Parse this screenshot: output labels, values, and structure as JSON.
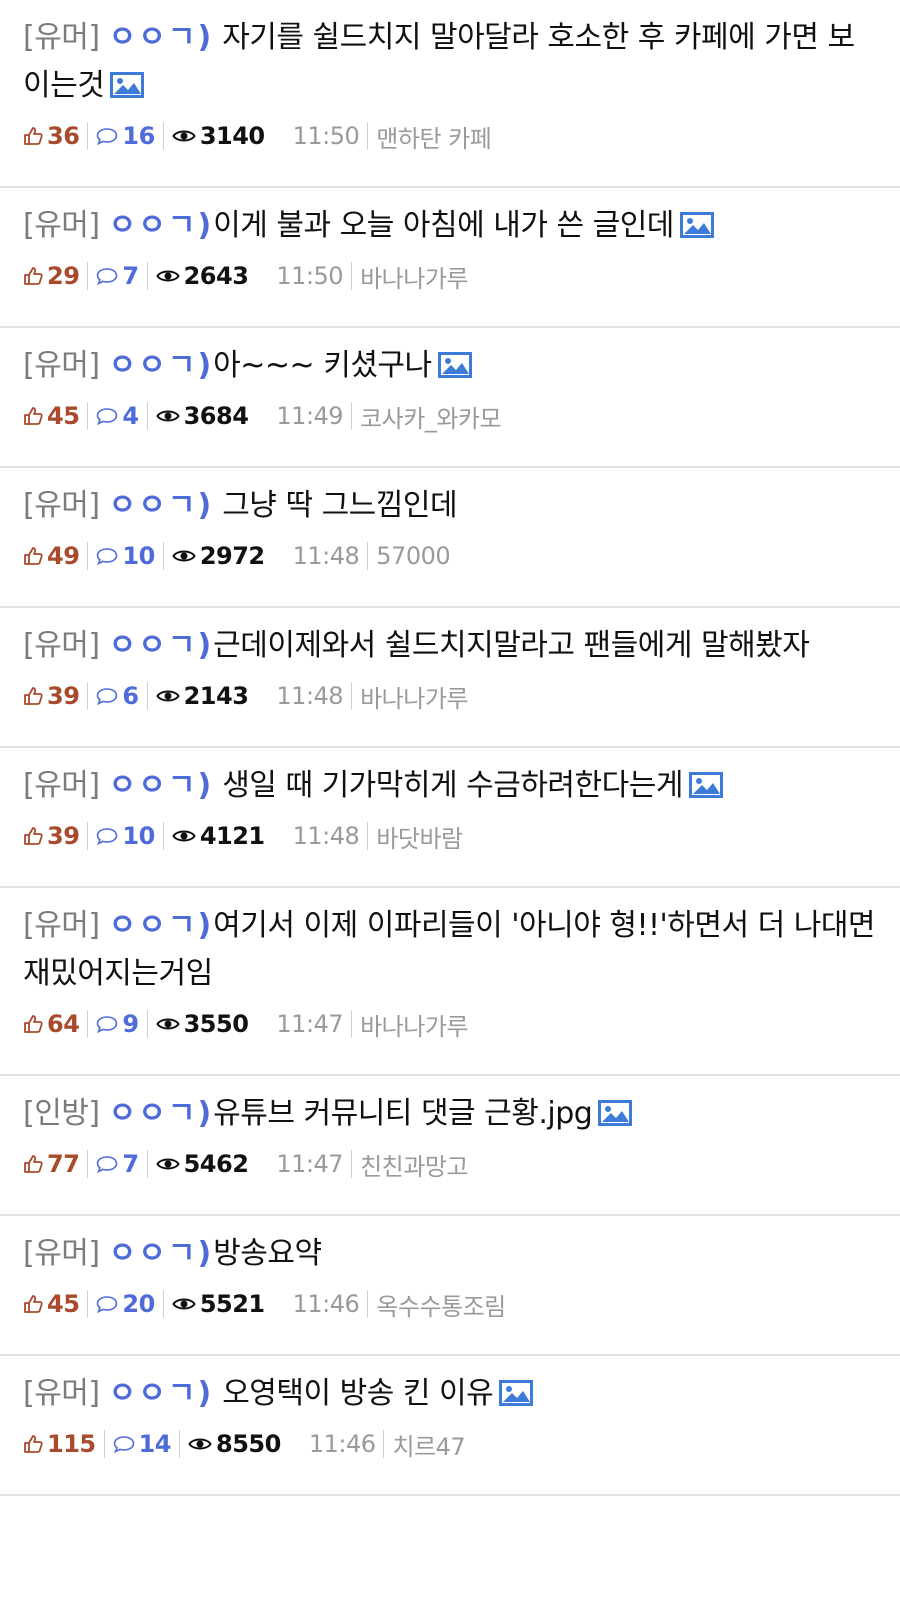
{
  "posts": [
    {
      "category": "[유머]",
      "gosu": "ㅇㅇㄱ)",
      "title": " 자기를 쉴드치지 말아달라 호소한 후 카페에 가면 보이는것",
      "has_image": true,
      "likes": "36",
      "comments": "16",
      "views": "3140",
      "time": "11:50",
      "author": "맨하탄 카페"
    },
    {
      "category": "[유머]",
      "gosu": "ㅇㅇㄱ)",
      "title": "이게 불과 오늘 아침에 내가 쓴 글인데",
      "has_image": true,
      "likes": "29",
      "comments": "7",
      "views": "2643",
      "time": "11:50",
      "author": "바나나가루"
    },
    {
      "category": "[유머]",
      "gosu": "ㅇㅇㄱ)",
      "title": "아~~~ 키셨구나",
      "has_image": true,
      "likes": "45",
      "comments": "4",
      "views": "3684",
      "time": "11:49",
      "author": "코사카_와카모"
    },
    {
      "category": "[유머]",
      "gosu": "ㅇㅇㄱ)",
      "title": " 그냥 딱 그느낌인데",
      "has_image": false,
      "likes": "49",
      "comments": "10",
      "views": "2972",
      "time": "11:48",
      "author": "57000"
    },
    {
      "category": "[유머]",
      "gosu": "ㅇㅇㄱ)",
      "title": "근데이제와서 쉴드치지말라고 팬들에게 말해봤자",
      "has_image": false,
      "likes": "39",
      "comments": "6",
      "views": "2143",
      "time": "11:48",
      "author": "바나나가루"
    },
    {
      "category": "[유머]",
      "gosu": "ㅇㅇㄱ)",
      "title": " 생일 때 기가막히게 수금하려한다는게",
      "has_image": true,
      "likes": "39",
      "comments": "10",
      "views": "4121",
      "time": "11:48",
      "author": "바닷바람"
    },
    {
      "category": "[유머]",
      "gosu": "ㅇㅇㄱ)",
      "title": "여기서 이제 이파리들이 '아니야 형!!'하면서 더 나대면 재밌어지는거임",
      "has_image": false,
      "likes": "64",
      "comments": "9",
      "views": "3550",
      "time": "11:47",
      "author": "바나나가루"
    },
    {
      "category": "[인방]",
      "gosu": "ㅇㅇㄱ)",
      "title": "유튜브 커뮤니티 댓글 근황.jpg",
      "has_image": true,
      "likes": "77",
      "comments": "7",
      "views": "5462",
      "time": "11:47",
      "author": "친친과망고"
    },
    {
      "category": "[유머]",
      "gosu": "ㅇㅇㄱ)",
      "title": "방송요약",
      "has_image": false,
      "likes": "45",
      "comments": "20",
      "views": "5521",
      "time": "11:46",
      "author": "옥수수통조림"
    },
    {
      "category": "[유머]",
      "gosu": "ㅇㅇㄱ)",
      "title": " 오영택이 방송 킨 이유",
      "has_image": true,
      "likes": "115",
      "comments": "14",
      "views": "8550",
      "time": "11:46",
      "author": "치르47"
    }
  ],
  "colors": {
    "gosu": "#4f6bd8",
    "likes": "#a94a2c",
    "meta_muted": "#9a9a9a",
    "divider": "#e2e2e2"
  },
  "icons": {
    "like": "thumbs-up-icon",
    "comment": "speech-bubble-icon",
    "view": "eye-icon",
    "image": "image-icon"
  }
}
